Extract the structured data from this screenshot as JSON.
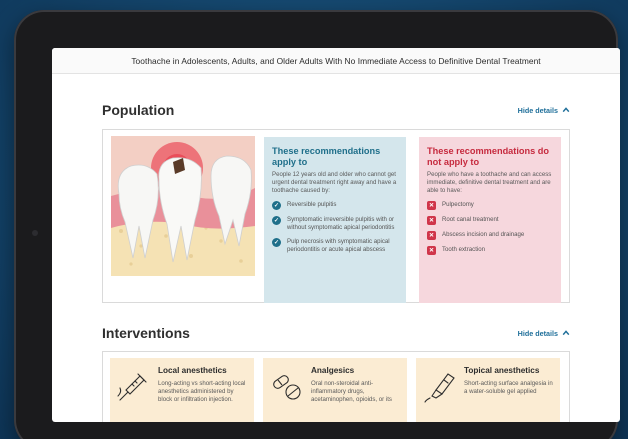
{
  "page": {
    "title": "Toothache in Adolescents, Adults, and Older Adults With No Immediate Access to Definitive Dental Treatment"
  },
  "population": {
    "heading": "Population",
    "toggle_label": "Hide details",
    "apply": {
      "title": "These recommendations apply to",
      "description": "People 12 years old and older who cannot get urgent dental treatment right away and have a toothache caused by:",
      "items": [
        "Reversible pulpitis",
        "Symptomatic irreversible pulpitis with or without symptomatic apical periodontitis",
        "Pulp necrosis with symptomatic apical periodontitis or acute apical abscess"
      ]
    },
    "not_apply": {
      "title": "These recommendations do not apply to",
      "description": "People who have a toothache and can access immediate, definitive dental treatment and are able to have:",
      "items": [
        "Pulpectomy",
        "Root canal treatment",
        "Abscess incision and drainage",
        "Tooth extraction"
      ]
    }
  },
  "interventions": {
    "heading": "Interventions",
    "toggle_label": "Hide details",
    "cards": [
      {
        "icon": "syringe-icon",
        "title": "Local anesthetics",
        "description": "Long-acting vs short-acting local anesthetics administered by block or infiltration injection."
      },
      {
        "icon": "pills-icon",
        "title": "Analgesics",
        "description": "Oral non-steroidal anti-inflammatory drugs, acetaminophen, opioids, or its"
      },
      {
        "icon": "gel-tube-icon",
        "title": "Topical anesthetics",
        "description": "Short-acting surface analgesia in a water-soluble gel applied"
      }
    ]
  },
  "colors": {
    "accent": "#1f6f9a",
    "apply_bg": "#d4e6ec",
    "not_apply_bg": "#f6d7dd",
    "intervention_bg": "#fbecd3"
  }
}
